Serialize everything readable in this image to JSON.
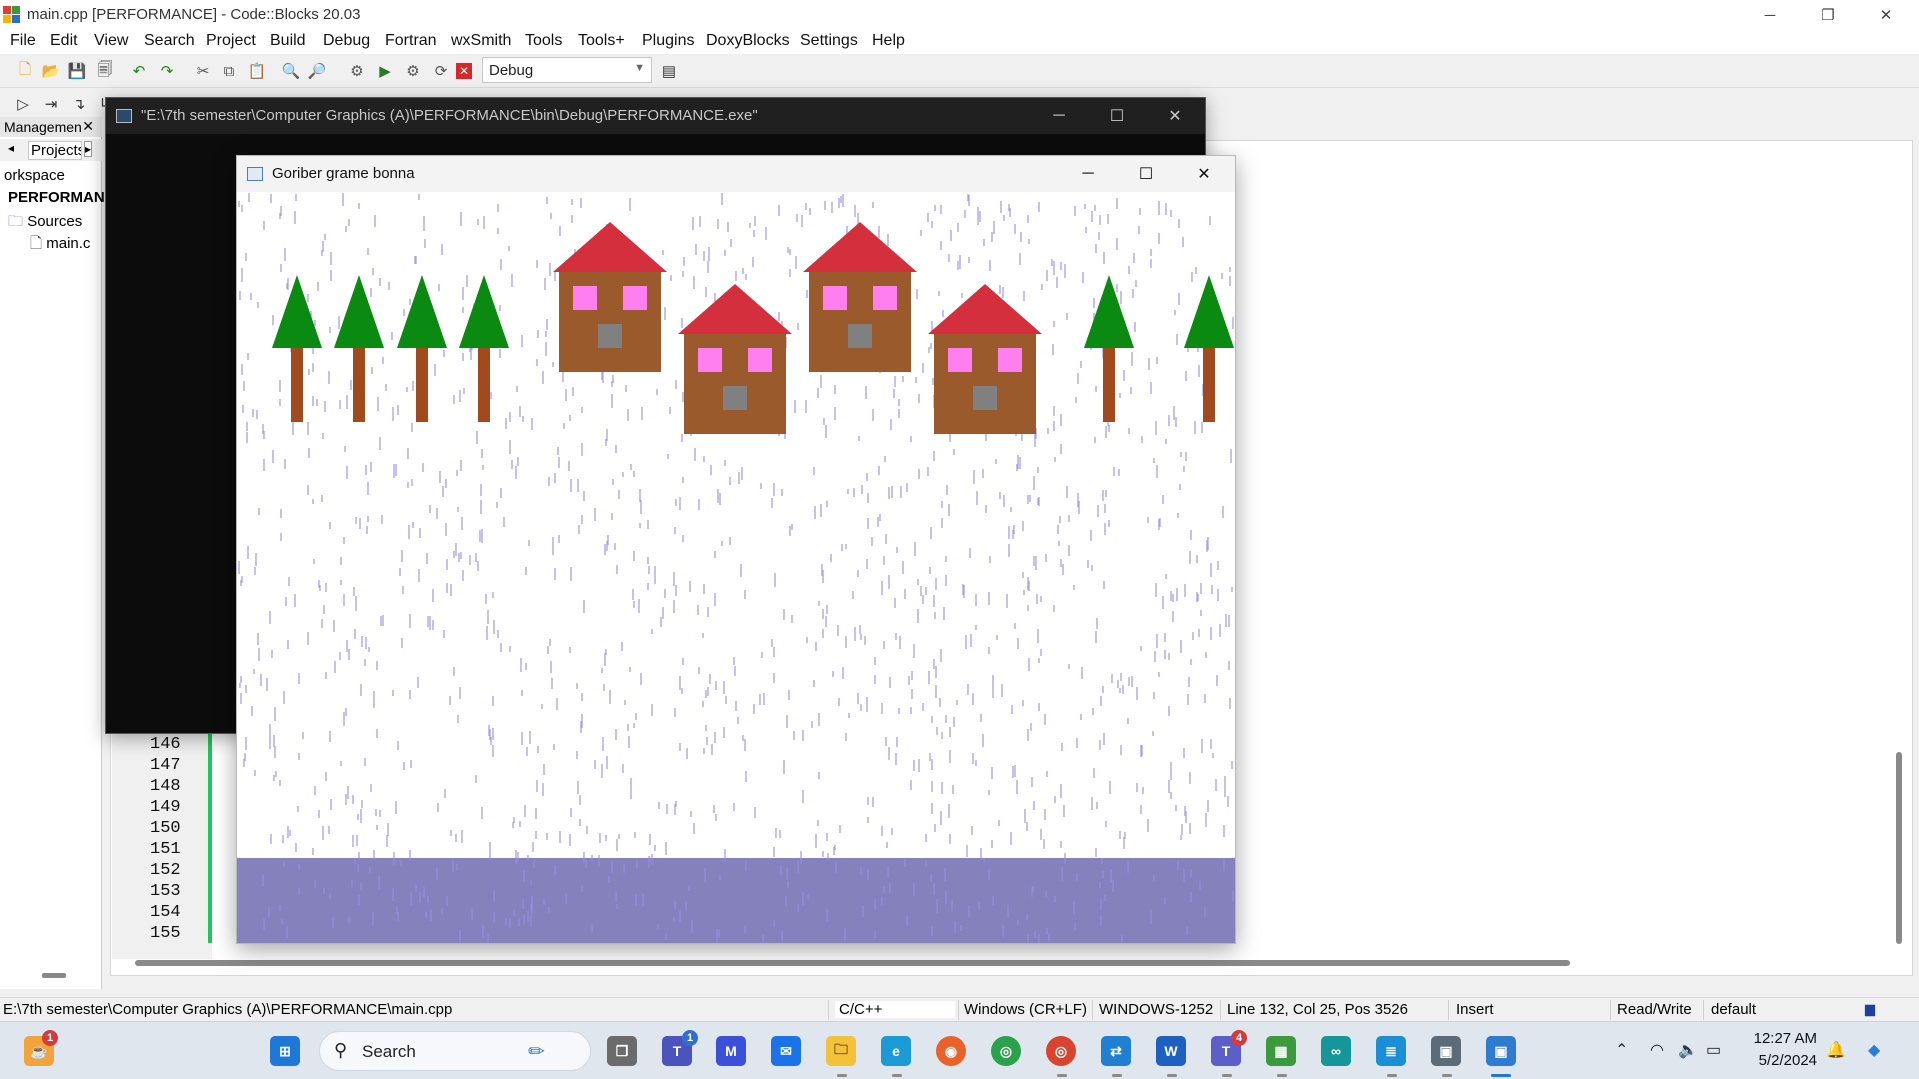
{
  "codeblocks": {
    "window_title": "main.cpp [PERFORMANCE] - Code::Blocks 20.03",
    "menu": [
      "File",
      "Edit",
      "View",
      "Search",
      "Project",
      "Build",
      "Debug",
      "Fortran",
      "wxSmith",
      "Tools",
      "Tools+",
      "Plugins",
      "DoxyBlocks",
      "Settings",
      "Help"
    ],
    "build_target": "Debug",
    "management": {
      "header": "Managemen",
      "tab": "Projects",
      "tree": [
        "orkspace",
        "PERFORMAN",
        "Sources",
        "main.c"
      ]
    },
    "line_numbers": [
      "146",
      "147",
      "148",
      "149",
      "150",
      "151",
      "152",
      "153",
      "154",
      "155"
    ]
  },
  "status_bar": {
    "file_path": "E:\\7th semester\\Computer Graphics (A)\\PERFORMANCE\\main.cpp",
    "language": "C/C++",
    "line_endings": "Windows (CR+LF)",
    "encoding": "WINDOWS-1252",
    "position": "Line 132, Col 25, Pos 3526",
    "mode": "Insert",
    "access": "Read/Write",
    "profile": "default"
  },
  "console": {
    "title": "\"E:\\7th semester\\Computer Graphics (A)\\PERFORMANCE\\bin\\Debug\\PERFORMANCE.exe\""
  },
  "graphics_window": {
    "title": "Goriber grame bonna",
    "colors": {
      "roof": "#d32f3c",
      "wall": "#9a5a2b",
      "window": "#ff7ff0",
      "door": "#808080",
      "tree_leaves": "#0a8a10",
      "trunk": "#a04a1e",
      "water": "#8481bd",
      "rain": "#9a8de6"
    }
  },
  "taskbar": {
    "search_label": "Search",
    "clock_time": "12:27 AM",
    "clock_date": "5/2/2024",
    "badges": {
      "notifications": "1",
      "teams": "1",
      "teams_work": "4"
    }
  }
}
